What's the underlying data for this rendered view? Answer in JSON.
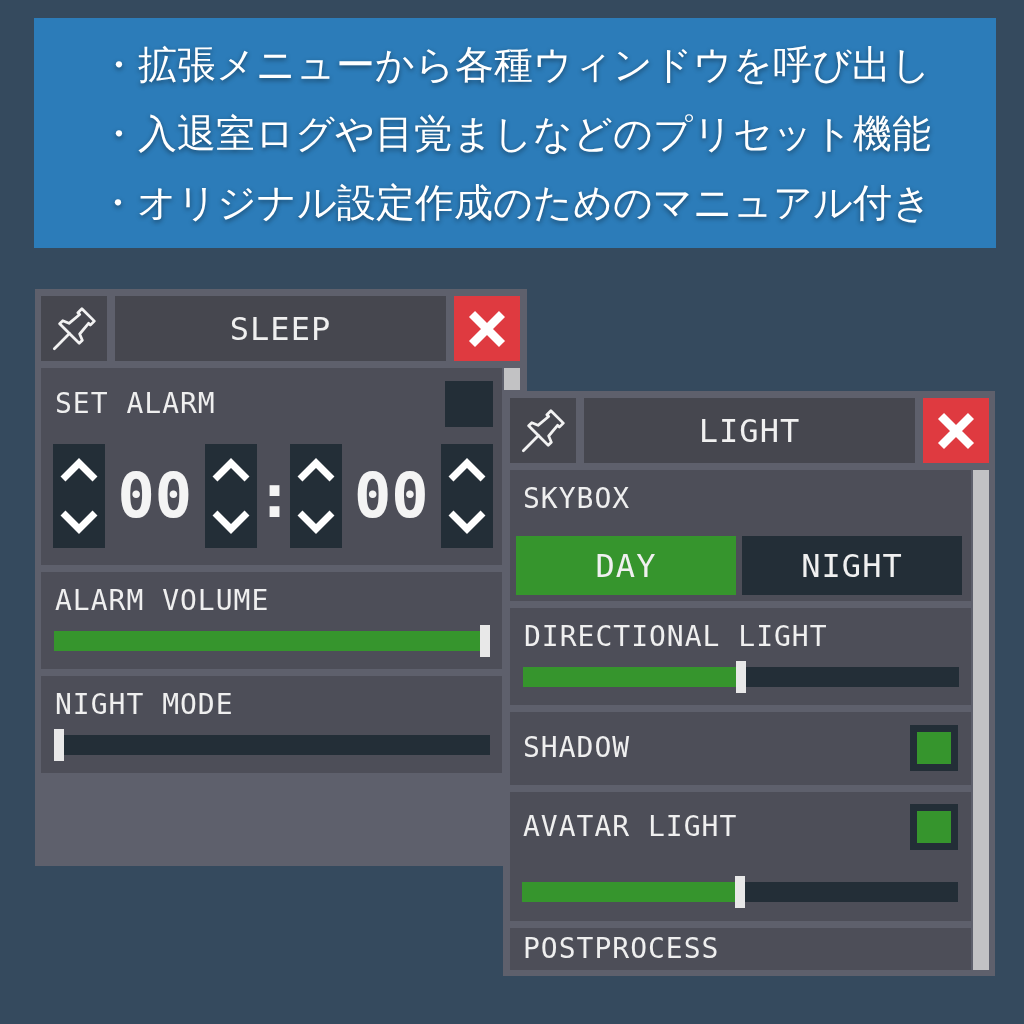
{
  "banner": {
    "lines": [
      "・拡張メニューから各種ウィンドウを呼び出し",
      "・入退室ログや目覚ましなどのプリセット機能",
      "・オリジナル設定作成のためのマニュアル付き"
    ]
  },
  "windows": [
    {
      "title": "SLEEP",
      "sections": [
        {
          "kind": "alarm",
          "label": "SET ALARM",
          "checked": false,
          "hours": "00",
          "separator": ":",
          "minutes": "00"
        },
        {
          "kind": "slider",
          "label": "ALARM VOLUME",
          "level": 1
        },
        {
          "kind": "slider",
          "label": "NIGHT MODE",
          "level": 0
        }
      ]
    },
    {
      "title": "LIGHT",
      "sections": [
        {
          "kind": "toggle",
          "label": "SKYBOX",
          "options": [
            {
              "label": "DAY",
              "selected": true
            },
            {
              "label": "NIGHT",
              "selected": false
            }
          ]
        },
        {
          "kind": "slider",
          "label": "DIRECTIONAL LIGHT",
          "level": 0.5
        },
        {
          "kind": "checkbox",
          "label": "SHADOW",
          "checked": true
        },
        {
          "kind": "checkbox_slider",
          "label": "AVATAR LIGHT",
          "checked": true,
          "level": 0.5
        },
        {
          "kind": "label",
          "label": "POSTPROCESS"
        }
      ]
    }
  ]
}
